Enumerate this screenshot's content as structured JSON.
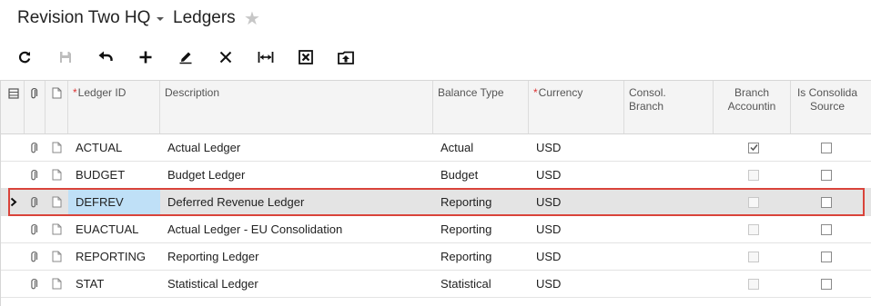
{
  "header": {
    "company": "Revision Two HQ",
    "screen_title": "Ledgers"
  },
  "toolbar": {
    "buttons": [
      "refresh-icon",
      "save-icon",
      "undo-icon",
      "add-icon",
      "edit-icon",
      "delete-icon",
      "fit-columns-icon",
      "export-excel-icon",
      "upload-icon"
    ]
  },
  "grid": {
    "columns": {
      "ledger_id": "Ledger ID",
      "description": "Description",
      "balance_type": "Balance Type",
      "currency": "Currency",
      "consol_branch": "Consol. Branch",
      "branch_accounting": "Branch Accountin",
      "is_consolidation_source": "Is Consolida Source"
    },
    "rows": [
      {
        "ledger_id": "ACTUAL",
        "description": "Actual Ledger",
        "balance_type": "Actual",
        "currency": "USD",
        "consol_branch": "",
        "branch_accounting": true,
        "is_consolidation_source": false
      },
      {
        "ledger_id": "BUDGET",
        "description": "Budget Ledger",
        "balance_type": "Budget",
        "currency": "USD",
        "consol_branch": "",
        "branch_accounting": false,
        "is_consolidation_source": false
      },
      {
        "ledger_id": "DEFREV",
        "description": "Deferred Revenue Ledger",
        "balance_type": "Reporting",
        "currency": "USD",
        "consol_branch": "",
        "branch_accounting": false,
        "is_consolidation_source": false
      },
      {
        "ledger_id": "EUACTUAL",
        "description": "Actual Ledger - EU Consolidation",
        "balance_type": "Reporting",
        "currency": "USD",
        "consol_branch": "",
        "branch_accounting": false,
        "is_consolidation_source": false
      },
      {
        "ledger_id": "REPORTING",
        "description": "Reporting Ledger",
        "balance_type": "Reporting",
        "currency": "USD",
        "consol_branch": "",
        "branch_accounting": false,
        "is_consolidation_source": false
      },
      {
        "ledger_id": "STAT",
        "description": "Statistical Ledger",
        "balance_type": "Statistical",
        "currency": "USD",
        "consol_branch": "",
        "branch_accounting": false,
        "is_consolidation_source": false
      }
    ],
    "selected_row": 2
  },
  "colors": {
    "highlight_border": "#d9433a",
    "selected_id_cell": "#bfe0f7",
    "selected_row": "#e4e4e4",
    "required_marker": "#d33333"
  }
}
